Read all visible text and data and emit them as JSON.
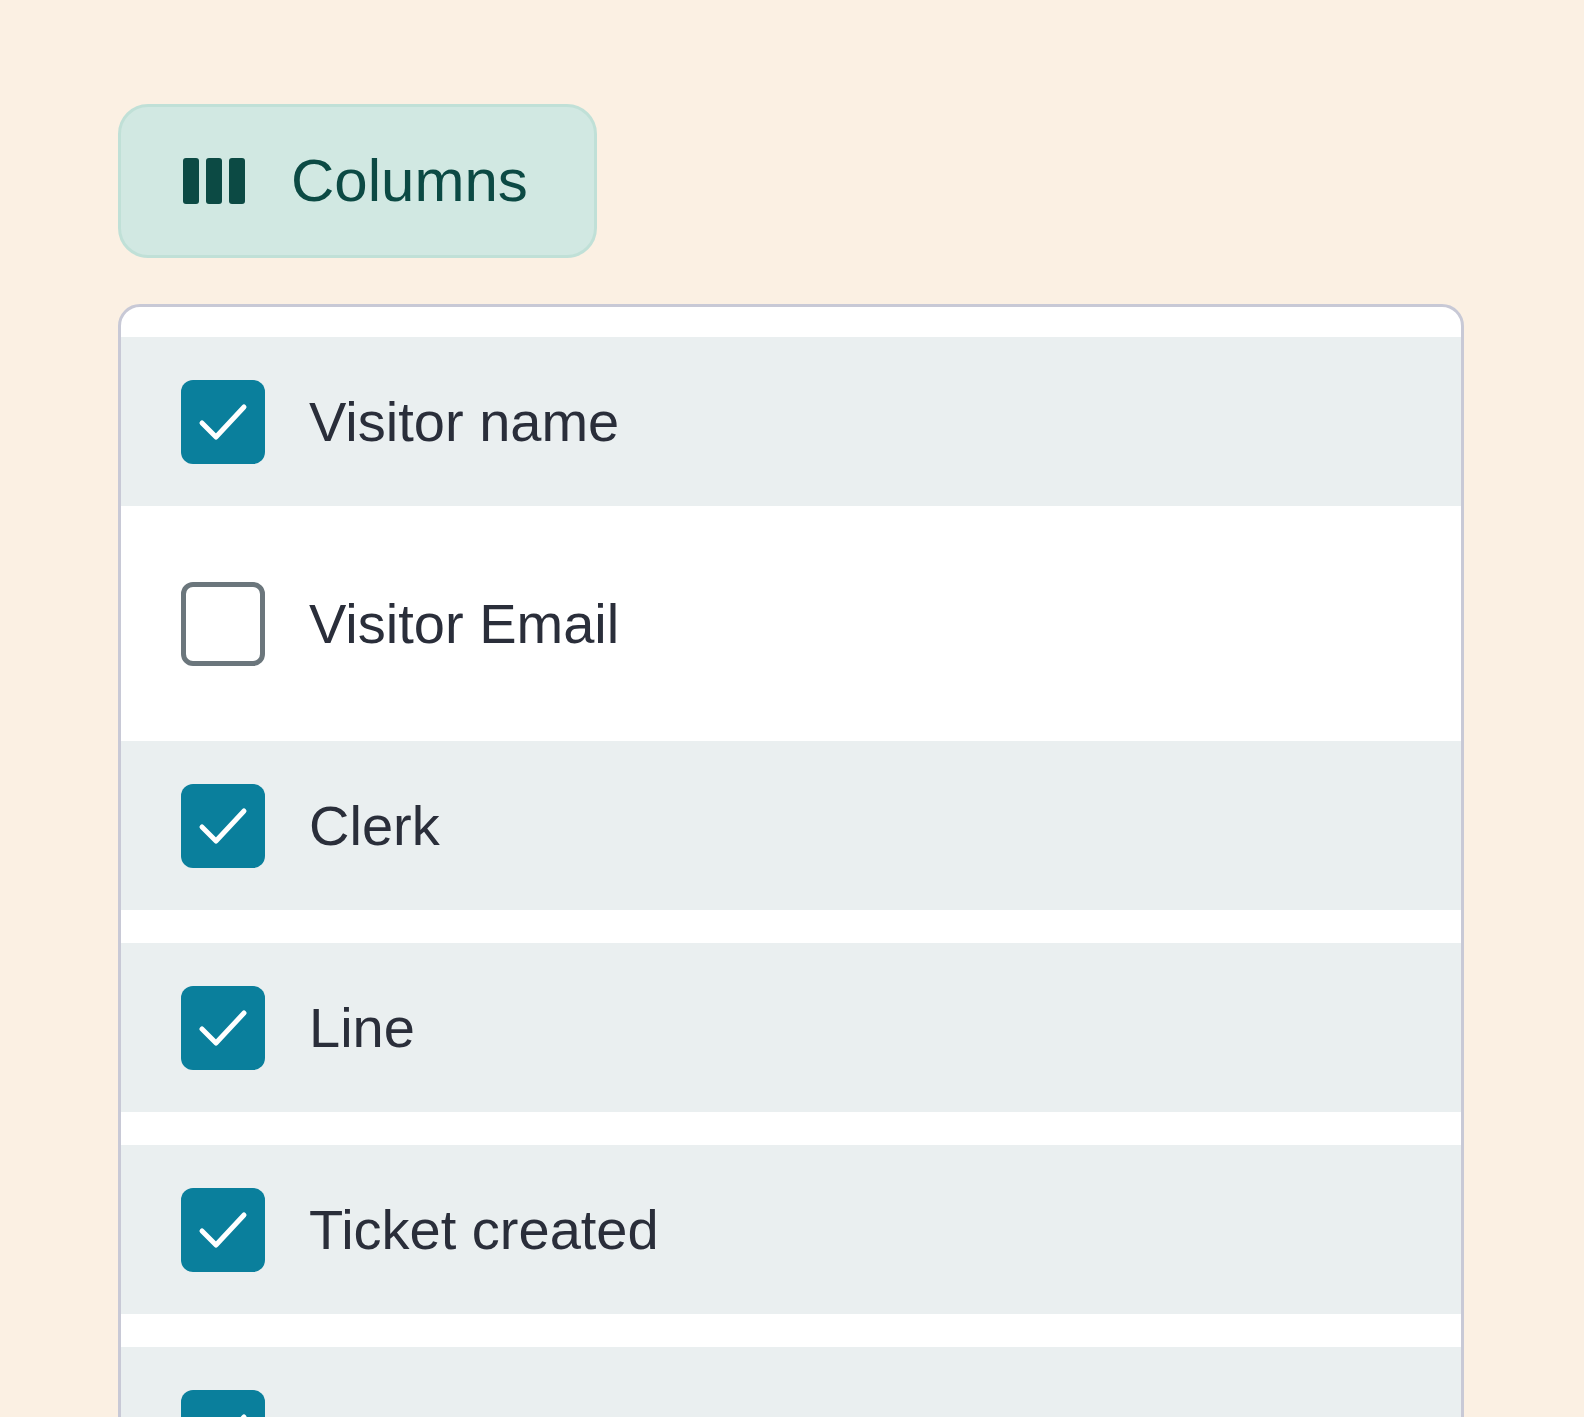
{
  "columns_button": {
    "label": "Columns"
  },
  "columns": [
    {
      "label": "Visitor name",
      "checked": true
    },
    {
      "label": "Visitor Email",
      "checked": false
    },
    {
      "label": "Clerk",
      "checked": true
    },
    {
      "label": "Line",
      "checked": true
    },
    {
      "label": "Ticket created",
      "checked": true
    },
    {
      "checked": true
    }
  ]
}
